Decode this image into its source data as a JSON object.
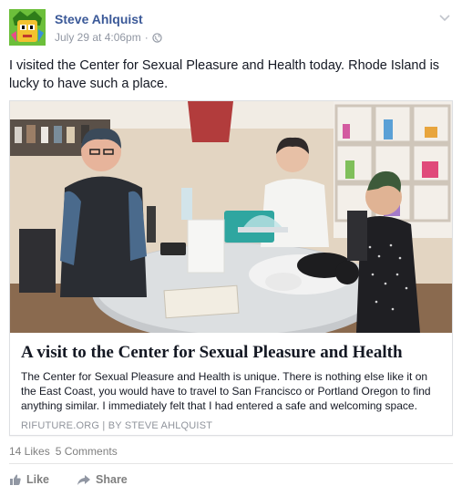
{
  "post": {
    "author": "Steve Ahlquist",
    "date": "July 29 at 4:06pm",
    "separator": "·",
    "audience_icon": "public-globe-icon",
    "text": "I visited the Center for Sexual Pleasure and Health today. Rhode Island is lucky to have such a place."
  },
  "link_card": {
    "title": "A visit to the Center for Sexual Pleasure and Health",
    "description": "The Center for Sexual Pleasure and Health is unique. There is nothing else like it on the East Coast, you would have to travel to San Francisco or Portland Oregon to find anything similar. I immediately felt that I had entered a safe and welcoming space.",
    "source": "RIFUTURE.ORG | BY STEVE AHLQUIST"
  },
  "stats": {
    "likes": "14 Likes",
    "comments": "5 Comments"
  },
  "actions": {
    "like": "Like",
    "share": "Share"
  },
  "colors": {
    "link_blue": "#3b5998",
    "meta_gray": "#9197a3"
  }
}
